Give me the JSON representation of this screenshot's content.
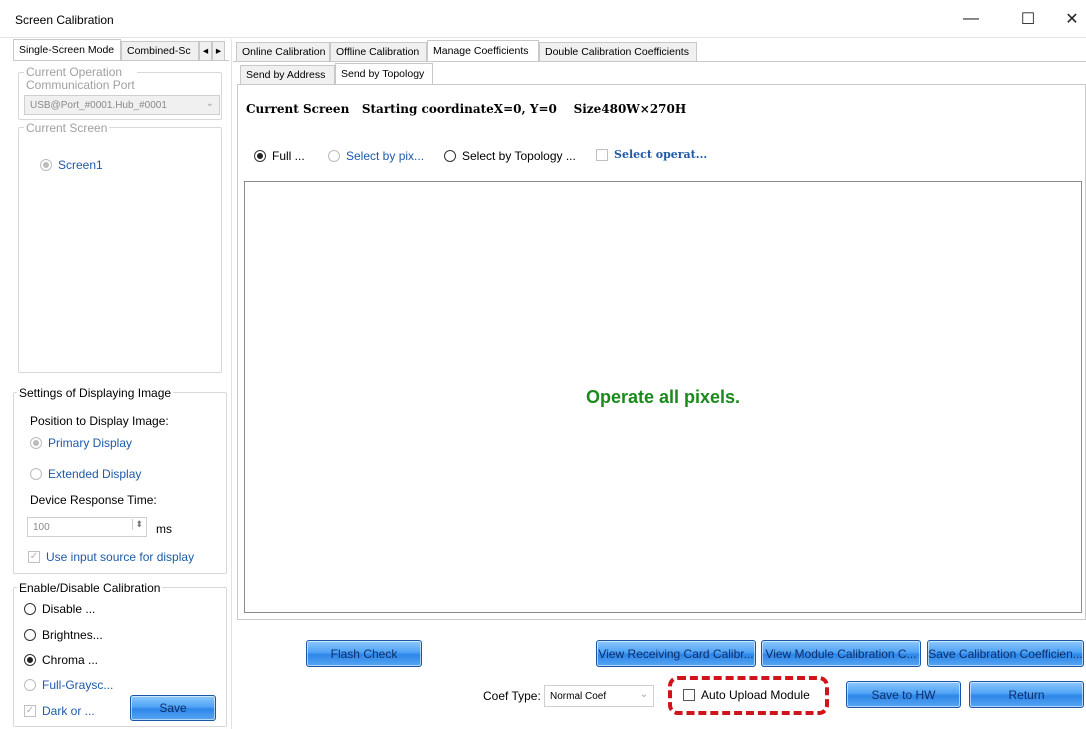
{
  "window": {
    "title": "Screen Calibration",
    "minimize": "—",
    "maximize": "☐",
    "close": "✕"
  },
  "left_tabs": {
    "single": "Single-Screen Mode",
    "combined": "Combined-Sc",
    "scroll_left": "◂",
    "scroll_right": "▸"
  },
  "left": {
    "comm_port": {
      "title_line1": "Current Operation",
      "title_line2": "Communication Port",
      "value": "USB@Port_#0001.Hub_#0001",
      "arrow": "⌄"
    },
    "current_screen": {
      "title": "Current Screen",
      "screen1": "Screen1"
    },
    "display_settings": {
      "title": "Settings of Displaying Image",
      "position_label": "Position to Display Image:",
      "primary": "Primary Display",
      "extended": "Extended Display",
      "response_label": "Device Response Time:",
      "response_value": "100",
      "response_unit": "ms",
      "use_input": "Use input source for display"
    },
    "calibration": {
      "title": "Enable/Disable Calibration",
      "disable": "Disable ...",
      "brightness": "Brightnes...",
      "chroma": "Chroma ...",
      "full_gray": "Full-Graysc...",
      "dark": "Dark or ...",
      "save": "Save"
    }
  },
  "main_tabs": [
    "Online Calibration",
    "Offline Calibration",
    "Manage Coefficients",
    "Double Calibration Coefficients"
  ],
  "sub_tabs": [
    "Send by Address",
    "Send by Topology"
  ],
  "screen_info": {
    "label": "Current Screen",
    "coord": "Starting coordinateX=0, Y=0",
    "size": "Size480W×270H"
  },
  "selection": {
    "full": "Full ...",
    "by_pixel": "Select by pix...",
    "by_topology": "Select by Topology ...",
    "select_operate": "Select operat..."
  },
  "canvas_message": "Operate all pixels.",
  "bottom": {
    "flash_check": "Flash Check",
    "view_receiving": "View Receiving Card Calibr...",
    "view_module": "View Module Calibration C...",
    "save_calib": "Save Calibration Coefficien...",
    "coef_type_label": "Coef Type:",
    "coef_type_value": "Normal Coef",
    "auto_upload": "Auto Upload Module",
    "save_hw": "Save to HW",
    "return": "Return"
  },
  "colors": {
    "accent_green": "#1a8a1a",
    "highlight_red": "#d0141c",
    "button_blue": "#3b8ff0"
  }
}
